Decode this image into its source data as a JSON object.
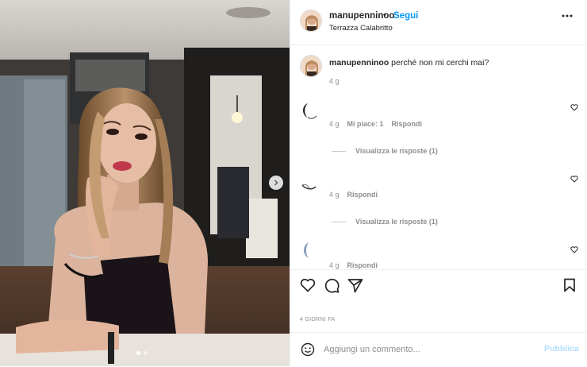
{
  "post": {
    "author": "manupenninoo",
    "separator": "•",
    "follow_label": "Segui",
    "location": "Terrazza Calabritto",
    "caption": {
      "username": "manupenninoo",
      "text": "perché non mi cerchi mai?",
      "time": "4 g"
    },
    "comments": [
      {
        "time": "4 g",
        "likes": "Mi piace: 1",
        "reply_label": "Rispondi",
        "view_replies": "Visualizza le risposte (1)"
      },
      {
        "time": "4 g",
        "reply_label": "Rispondi",
        "view_replies": "Visualizza le risposte (1)"
      },
      {
        "time": "4 g",
        "reply_label": "Rispondi"
      }
    ],
    "timestamp": "4 GIORNI FA",
    "comment_input": {
      "placeholder": "Aggiungi un commento...",
      "publish_label": "Pubblica"
    },
    "carousel": {
      "slide_count": 2,
      "active_index": 0
    },
    "colors": {
      "link": "#0095f6",
      "muted": "#8e8e8e",
      "text": "#262626",
      "publish_disabled": "#b2dffc"
    },
    "icons": [
      "more-options-icon",
      "heart-icon",
      "comment-icon",
      "share-icon",
      "save-icon",
      "emoji-icon",
      "chevron-right-icon"
    ]
  }
}
